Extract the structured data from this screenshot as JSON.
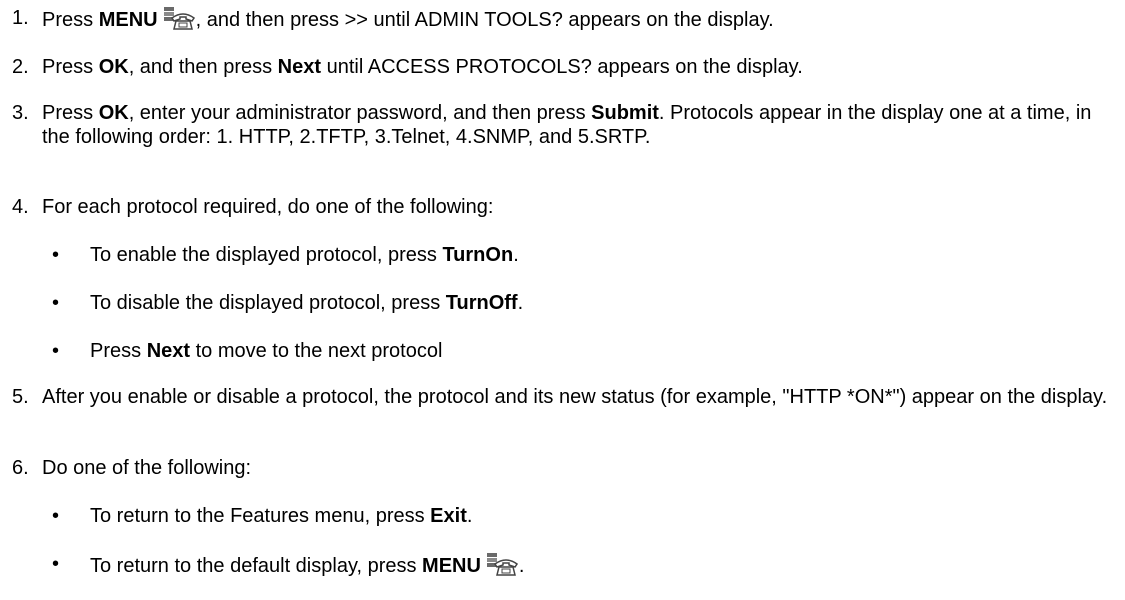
{
  "steps": [
    {
      "num": "1.",
      "t1": "Press ",
      "b1": "MENU",
      "t2": ", and then press >> until ADMIN TOOLS? appears on the display."
    },
    {
      "num": "2.",
      "t1": "Press ",
      "b1": "OK",
      "t2": ", and then press ",
      "b2": "Next",
      "t3": " until ACCESS PROTOCOLS? appears on the display."
    },
    {
      "num": "3.",
      "t1": "Press ",
      "b1": "OK",
      "t2": ", enter your administrator password, and then press ",
      "b2": "Submit",
      "t3": ". Protocols appear in the display one at a time, in the following order:  1. HTTP, 2.TFTP, 3.Telnet, 4.SNMP, and 5.SRTP."
    },
    {
      "num": "4.",
      "t1": "For each protocol required, do one of the following:",
      "bullets": [
        {
          "t1": "To enable the displayed protocol, press ",
          "b1": "TurnOn",
          "t2": "."
        },
        {
          "t1": "To disable the displayed protocol, press ",
          "b1": "TurnOff",
          "t2": "."
        },
        {
          "t1": "Press ",
          "b1": "Next",
          "t2": " to move to the next protocol"
        }
      ]
    },
    {
      "num": "5.",
      "t1": "After you enable or disable a protocol, the protocol and its new status (for example, \"HTTP *ON*\") appear on the display."
    },
    {
      "num": "6.",
      "t1": "Do one of the following:",
      "bullets": [
        {
          "t1": "To return to the Features menu, press ",
          "b1": "Exit",
          "t2": "."
        },
        {
          "t1": "To return to the default display, press ",
          "b1": "MENU",
          "t2": "."
        }
      ]
    }
  ],
  "icons": {
    "menu_key": "phone-menu-icon"
  }
}
